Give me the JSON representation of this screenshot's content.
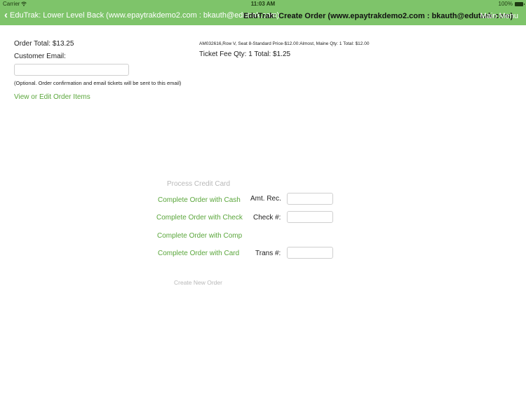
{
  "status_bar": {
    "carrier": "Carrier",
    "wifi_icon": "wifi-icon",
    "time": "11:03 AM",
    "battery_percent": "100%",
    "battery_icon": "battery-icon"
  },
  "nav": {
    "back_label": "EduTrak: Lower Level Back (www.epaytrakdemo2.com : bkauth@edutrak.com)",
    "back_icon": "chevron-left-icon",
    "title": "EduTrak: Create Order (www.epaytrakdemo2.com : bkauth@edutrak.com)",
    "right_button": "Main Menu",
    "color": "#7ec46a"
  },
  "order": {
    "total": "Order Total: $13.25",
    "email_label": "Customer Email:",
    "email_value": "",
    "email_note": "(Optional. Order confirmation and email tickets will be sent to this email)",
    "view_edit_link": "View or Edit Order Items",
    "item_line": "AM032616,Row V, Seat 8-Standard Price-$12.00:Almost, Maine Qty: 1 Total: $12.00",
    "ticket_fee": "Ticket Fee Qty: 1 Total: $1.25"
  },
  "payment": {
    "process_credit_card": "Process Credit Card",
    "complete_cash": "Complete Order with Cash",
    "amt_rec_label": "Amt. Rec.",
    "amt_rec_value": "",
    "complete_check": "Complete Order with Check",
    "check_label": "Check #:",
    "check_value": "",
    "complete_comp": "Complete Order with Comp",
    "complete_card": "Complete Order with Card",
    "trans_label": "Trans #:",
    "trans_value": "",
    "create_new_order": "Create New Order"
  },
  "colors": {
    "accent": "#5aa63b",
    "disabled": "#b8b8b8"
  }
}
